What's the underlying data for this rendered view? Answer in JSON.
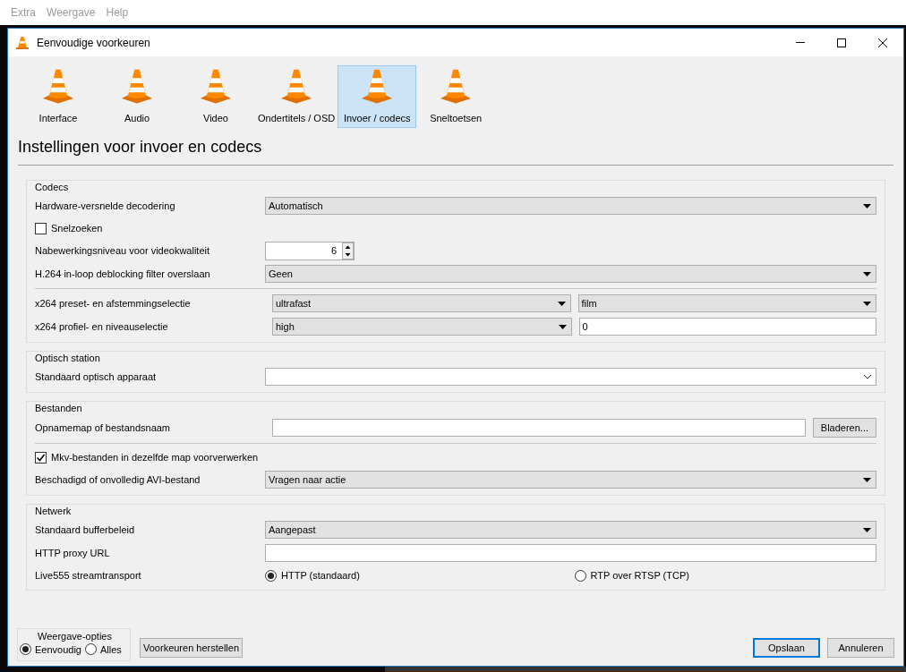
{
  "menu": [
    "Extra",
    "Weergave",
    "Help"
  ],
  "window": {
    "title": "Eenvoudige voorkeuren"
  },
  "categories": [
    {
      "label": "Interface",
      "selected": false
    },
    {
      "label": "Audio",
      "selected": false
    },
    {
      "label": "Video",
      "selected": false
    },
    {
      "label": "Ondertitels / OSD",
      "selected": false
    },
    {
      "label": "Invoer / codecs",
      "selected": true
    },
    {
      "label": "Sneltoetsen",
      "selected": false
    }
  ],
  "heading": "Instellingen voor invoer en codecs",
  "sections": [
    {
      "title": "Codecs",
      "rows": [
        {
          "kind": "select",
          "label": "Hardware-versnelde decodering",
          "value": "Automatisch"
        },
        {
          "kind": "checkbox",
          "label": "Snelzoeken",
          "checked": false
        },
        {
          "kind": "spin",
          "label": "Nabewerkingsniveau voor videokwaliteit",
          "value": "6"
        },
        {
          "kind": "select",
          "label": "H.264 in-loop deblocking filter overslaan",
          "value": "Geen"
        },
        {
          "kind": "separator"
        },
        {
          "kind": "select_pair",
          "label": "x264 preset- en afstemmingselectie",
          "value": "ultrafast",
          "value2": "film"
        },
        {
          "kind": "select_text",
          "label": "x264 profiel- en niveauselectie",
          "value": "high",
          "value2": "0"
        }
      ]
    },
    {
      "title": "Optisch station",
      "rows": [
        {
          "kind": "combo",
          "label": "Standaard optisch apparaat"
        }
      ]
    },
    {
      "title": "Bestanden",
      "rows": [
        {
          "kind": "file",
          "label": "Opnamemap of bestandsnaam",
          "button": "Bladeren..."
        },
        {
          "kind": "separator"
        },
        {
          "kind": "checkbox",
          "label": "Mkv-bestanden in dezelfde map voorverwerken",
          "checked": true
        },
        {
          "kind": "select",
          "label": "Beschadigd of onvolledig AVI-bestand",
          "value": "Vragen naar actie"
        }
      ]
    },
    {
      "title": "Netwerk",
      "rows": [
        {
          "kind": "select",
          "label": "Standaard bufferbeleid",
          "value": "Aangepast"
        },
        {
          "kind": "text",
          "label": "HTTP proxy URL"
        },
        {
          "kind": "radio",
          "label": "Live555 streamtransport",
          "options": [
            {
              "label": "HTTP (standaard)",
              "selected": true
            },
            {
              "label": "RTP over RTSP (TCP)",
              "selected": false
            }
          ]
        }
      ]
    }
  ],
  "display_options": {
    "title": "Weergave-opties",
    "options": [
      {
        "label": "Eenvoudig",
        "selected": true
      },
      {
        "label": "Alles",
        "selected": false
      }
    ]
  },
  "buttons": {
    "reset": "Voorkeuren herstellen",
    "save": "Opslaan",
    "cancel": "Annuleren"
  }
}
